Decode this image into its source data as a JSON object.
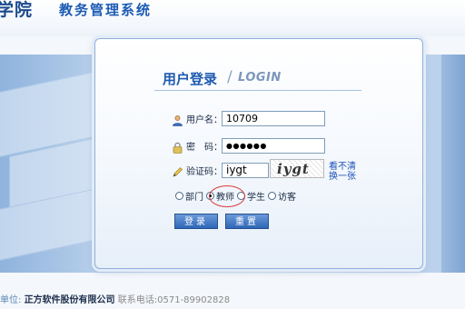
{
  "header": {
    "school_fragment": "学院",
    "system_title": "教务管理系统"
  },
  "login": {
    "title": "用户登录",
    "separator": "/",
    "subtitle": "LOGIN",
    "username_label": "用户名：",
    "username_value": "10709",
    "password_label": "密　码：",
    "password_value": "●●●●●●",
    "captcha_label": "验证码：",
    "captcha_value": "iygt",
    "captcha_image_text": "iygt",
    "captcha_refresh_line1": "看不清",
    "captcha_refresh_line2": "换一张",
    "roles": [
      {
        "label": "部门",
        "checked": false
      },
      {
        "label": "教师",
        "checked": true
      },
      {
        "label": "学生",
        "checked": false
      },
      {
        "label": "访客",
        "checked": false
      }
    ],
    "login_button": "登录",
    "reset_button": "重置"
  },
  "footer": {
    "unit_label": "单位:",
    "company": "正方软件股份有限公司",
    "phone_label": "联系电话:",
    "phone": "0571-89902828"
  },
  "colors": {
    "accent": "#1d5ab0",
    "highlight": "#d9393b"
  }
}
